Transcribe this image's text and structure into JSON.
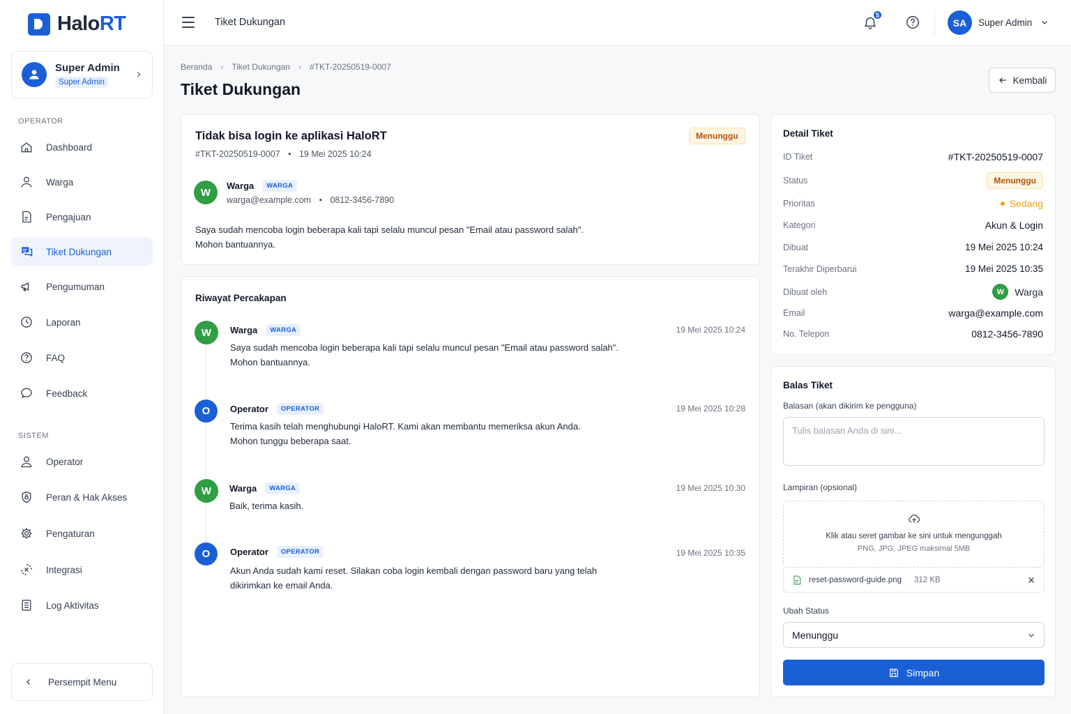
{
  "app": {
    "logo_prefix": "Halo",
    "logo_suffix": "RT"
  },
  "profile": {
    "name": "Super Admin",
    "role": "Super Admin"
  },
  "sidebar": {
    "section_operator": "OPERATOR",
    "section_system": "SISTEM",
    "operator_items": [
      {
        "label": "Dashboard",
        "icon": "home-icon"
      },
      {
        "label": "Warga",
        "icon": "user-icon"
      },
      {
        "label": "Pengajuan",
        "icon": "document-icon"
      },
      {
        "label": "Tiket Dukungan",
        "icon": "chat-icon",
        "active": true
      },
      {
        "label": "Pengumuman",
        "icon": "megaphone-icon"
      },
      {
        "label": "Laporan",
        "icon": "clock-icon"
      },
      {
        "label": "FAQ",
        "icon": "question-icon"
      },
      {
        "label": "Feedback",
        "icon": "message-icon"
      }
    ],
    "system_items": [
      {
        "label": "Operator",
        "icon": "user-icon"
      },
      {
        "label": "Peran & Hak Akses",
        "icon": "shield-icon"
      },
      {
        "label": "Pengaturan",
        "icon": "gear-icon"
      },
      {
        "label": "Integrasi",
        "icon": "integration-icon"
      },
      {
        "label": "Log Aktivitas",
        "icon": "list-icon"
      }
    ],
    "collapse_label": "Persempit Menu"
  },
  "topbar": {
    "title": "Tiket Dukungan",
    "notification_count": "5",
    "user_initials": "SA",
    "user_name": "Super Admin"
  },
  "breadcrumb": [
    "Beranda",
    "Tiket Dukungan",
    "#TKT-20250519-0007"
  ],
  "page": {
    "title": "Tiket Dukungan",
    "back_label": "Kembali"
  },
  "ticket": {
    "title": "Tidak bisa login ke aplikasi HaloRT",
    "id": "#TKT-20250519-0007",
    "date": "19 Mei 2025 10:24",
    "status": "Menunggu",
    "reporter": {
      "initial": "W",
      "name": "Warga",
      "tag": "WARGA",
      "email": "warga@example.com",
      "phone": "0812-3456-7890"
    },
    "message_line1": "Saya sudah mencoba login beberapa kali tapi selalu muncul pesan \"Email atau password salah\".",
    "message_line2": "Mohon bantuannya."
  },
  "history": {
    "title": "Riwayat Percakapan",
    "messages": [
      {
        "initial": "W",
        "name": "Warga",
        "tag": "WARGA",
        "time": "19 Mei 2025 10:24",
        "line1": "Saya sudah mencoba login beberapa kali tapi selalu muncul pesan \"Email atau password salah\".",
        "line2": "Mohon bantuannya."
      },
      {
        "initial": "O",
        "name": "Operator",
        "tag": "OPERATOR",
        "time": "19 Mei 2025 10:28",
        "line1": "Terima kasih telah menghubungi HaloRT. Kami akan membantu memeriksa akun Anda.",
        "line2": "Mohon tunggu beberapa saat."
      },
      {
        "initial": "W",
        "name": "Warga",
        "tag": "WARGA",
        "time": "19 Mei 2025 10:30",
        "line1": "Baik, terima kasih.",
        "line2": ""
      },
      {
        "initial": "O",
        "name": "Operator",
        "tag": "OPERATOR",
        "time": "19 Mei 2025 10:35",
        "line1": "Akun Anda sudah kami reset. Silakan coba login kembali dengan password baru yang telah",
        "line2": "dikirimkan ke email Anda."
      }
    ]
  },
  "detail": {
    "title": "Detail Tiket",
    "id_label": "ID Tiket",
    "id_value": "#TKT-20250519-0007",
    "status_label": "Status",
    "status_value": "Menunggu",
    "priority_label": "Prioritas",
    "priority_value": "Sedang",
    "category_label": "Kategori",
    "category_value": "Akun & Login",
    "created_label": "Dibuat",
    "created_value": "19 Mei 2025 10:24",
    "updated_label": "Terakhir Diperbarui",
    "updated_value": "19 Mei 2025 10:35",
    "creator_label": "Dibuat oleh",
    "creator_initial": "W",
    "creator_value": "Warga",
    "email_label": "Email",
    "email_value": "warga@example.com",
    "phone_label": "No. Telepon",
    "phone_value": "0812-3456-7890"
  },
  "reply": {
    "title": "Balas Tiket",
    "reply_label": "Balasan (akan dikirim ke pengguna)",
    "reply_placeholder": "Tulis balasan Anda di sini...",
    "attachment_label": "Lampiran (opsional)",
    "dropzone_text": "Klik atau seret gambar ke sini untuk mengunggah",
    "dropzone_hint": "PNG, JPG, JPEG maksimal 5MB",
    "file_name": "reset-password-guide.png",
    "file_size": "312 KB",
    "status_label": "Ubah Status",
    "status_value": "Menunggu",
    "save_label": "Simpan"
  },
  "colors": {
    "brand": "#1a5fd6",
    "green": "#2f9e44",
    "warning": "#b45309",
    "priority": "#f59e0b"
  }
}
